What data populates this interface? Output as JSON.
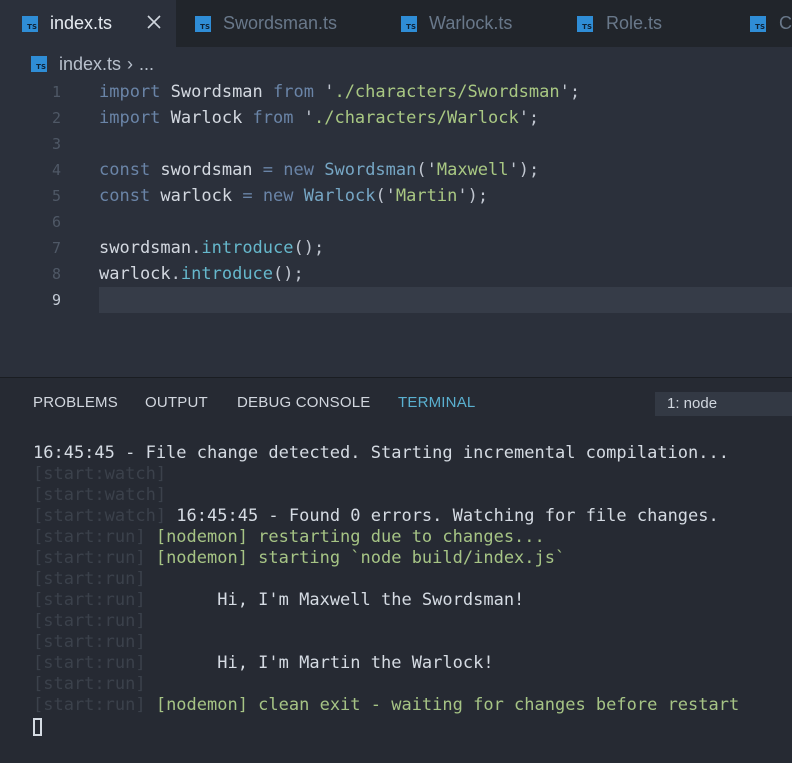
{
  "tabs": [
    {
      "badge": "TS",
      "label": "index.ts",
      "active": true
    },
    {
      "badge": "TS",
      "label": "Swordsman.ts"
    },
    {
      "badge": "TS",
      "label": "Warlock.ts"
    },
    {
      "badge": "TS",
      "label": "Role.ts"
    },
    {
      "badge": "TS",
      "label": "C"
    }
  ],
  "breadcrumb": {
    "badge": "TS",
    "file": "index.ts",
    "sep": "›",
    "more": "..."
  },
  "editor": {
    "line_numbers": [
      "1",
      "2",
      "3",
      "4",
      "5",
      "6",
      "7",
      "8",
      "9"
    ],
    "current_line": "9",
    "lines": [
      [
        {
          "t": "import",
          "c": "kw"
        },
        {
          "t": " Swordsman ",
          "c": "id"
        },
        {
          "t": "from",
          "c": "kw"
        },
        {
          "t": " '",
          "c": "pun"
        },
        {
          "t": "./characters/Swordsman",
          "c": "str"
        },
        {
          "t": "';",
          "c": "pun"
        }
      ],
      [
        {
          "t": "import",
          "c": "kw"
        },
        {
          "t": " Warlock ",
          "c": "id"
        },
        {
          "t": "from",
          "c": "kw"
        },
        {
          "t": " '",
          "c": "pun"
        },
        {
          "t": "./characters/Warlock",
          "c": "str"
        },
        {
          "t": "';",
          "c": "pun"
        }
      ],
      [],
      [
        {
          "t": "const",
          "c": "kw"
        },
        {
          "t": " swordsman ",
          "c": "id"
        },
        {
          "t": "=",
          "c": "kw"
        },
        {
          "t": " ",
          "c": "id"
        },
        {
          "t": "new",
          "c": "kw"
        },
        {
          "t": " ",
          "c": "id"
        },
        {
          "t": "Swordsman",
          "c": "cls"
        },
        {
          "t": "('",
          "c": "pun"
        },
        {
          "t": "Maxwell",
          "c": "str"
        },
        {
          "t": "');",
          "c": "pun"
        }
      ],
      [
        {
          "t": "const",
          "c": "kw"
        },
        {
          "t": " warlock ",
          "c": "id"
        },
        {
          "t": "=",
          "c": "kw"
        },
        {
          "t": " ",
          "c": "id"
        },
        {
          "t": "new",
          "c": "kw"
        },
        {
          "t": " ",
          "c": "id"
        },
        {
          "t": "Warlock",
          "c": "cls"
        },
        {
          "t": "('",
          "c": "pun"
        },
        {
          "t": "Martin",
          "c": "str"
        },
        {
          "t": "');",
          "c": "pun"
        }
      ],
      [],
      [
        {
          "t": "swordsman",
          "c": "id"
        },
        {
          "t": ".",
          "c": "pun"
        },
        {
          "t": "introduce",
          "c": "fn"
        },
        {
          "t": "();",
          "c": "pun"
        }
      ],
      [
        {
          "t": "warlock",
          "c": "id"
        },
        {
          "t": ".",
          "c": "pun"
        },
        {
          "t": "introduce",
          "c": "fn"
        },
        {
          "t": "();",
          "c": "pun"
        }
      ],
      []
    ]
  },
  "panel": {
    "tabs": [
      {
        "label": "PROBLEMS"
      },
      {
        "label": "OUTPUT"
      },
      {
        "label": "DEBUG CONSOLE"
      },
      {
        "label": "TERMINAL",
        "active": true
      }
    ],
    "terminal_select": "1: node"
  },
  "terminal": [
    [
      {
        "t": "16:45:45 - File change detected. Starting incremental compilation...",
        "c": "white"
      }
    ],
    [
      {
        "t": "[start:watch]",
        "c": "tag"
      }
    ],
    [
      {
        "t": "[start:watch]",
        "c": "tag"
      }
    ],
    [
      {
        "t": "[start:watch]",
        "c": "tag"
      },
      {
        "t": " 16:45:45 - Found 0 errors. Watching for file changes.",
        "c": "white"
      }
    ],
    [
      {
        "t": "[start:run]",
        "c": "tag"
      },
      {
        "t": " [nodemon] restarting due to changes...",
        "c": "green"
      }
    ],
    [
      {
        "t": "[start:run]",
        "c": "tag"
      },
      {
        "t": " [nodemon] starting `node build/index.js`",
        "c": "green"
      }
    ],
    [
      {
        "t": "[start:run]",
        "c": "tag"
      }
    ],
    [
      {
        "t": "[start:run]",
        "c": "tag"
      },
      {
        "t": "       Hi, I'm Maxwell the Swordsman!",
        "c": "white"
      }
    ],
    [
      {
        "t": "[start:run]",
        "c": "tag"
      }
    ],
    [
      {
        "t": "[start:run]",
        "c": "tag"
      }
    ],
    [
      {
        "t": "[start:run]",
        "c": "tag"
      },
      {
        "t": "       Hi, I'm Martin the Warlock!",
        "c": "white"
      }
    ],
    [
      {
        "t": "[start:run]",
        "c": "tag"
      }
    ],
    [
      {
        "t": "[start:run]",
        "c": "tag"
      },
      {
        "t": " [nodemon] clean exit - waiting for changes before restart",
        "c": "green"
      }
    ]
  ]
}
